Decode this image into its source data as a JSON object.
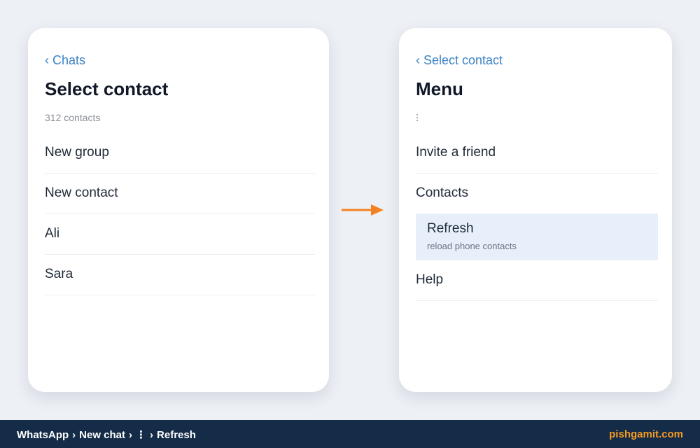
{
  "left_screen": {
    "back_label": "Chats",
    "title": "Select contact",
    "subtitle": "312 contacts",
    "items": [
      {
        "label": "New group"
      },
      {
        "label": "New contact"
      },
      {
        "label": "Ali"
      },
      {
        "label": "Sara"
      }
    ]
  },
  "right_screen": {
    "back_label": "Select contact",
    "title": "Menu",
    "menu_icon": "more-vertical-icon",
    "items": [
      {
        "label": "Invite a friend"
      },
      {
        "label": "Contacts"
      },
      {
        "label": "Refresh",
        "description": "reload phone contacts",
        "highlighted": true
      },
      {
        "label": "Help"
      }
    ]
  },
  "transition_icon": "arrow-right-icon",
  "footer": {
    "breadcrumb": [
      "WhatsApp",
      "New chat",
      "⋮",
      "Refresh"
    ],
    "brand": "pishgamit.com"
  },
  "colors": {
    "accent": "#3b82c4",
    "arrow": "#f58220",
    "highlight": "#e7effb",
    "footer_bg": "#142c48",
    "brand": "#f59a23"
  }
}
